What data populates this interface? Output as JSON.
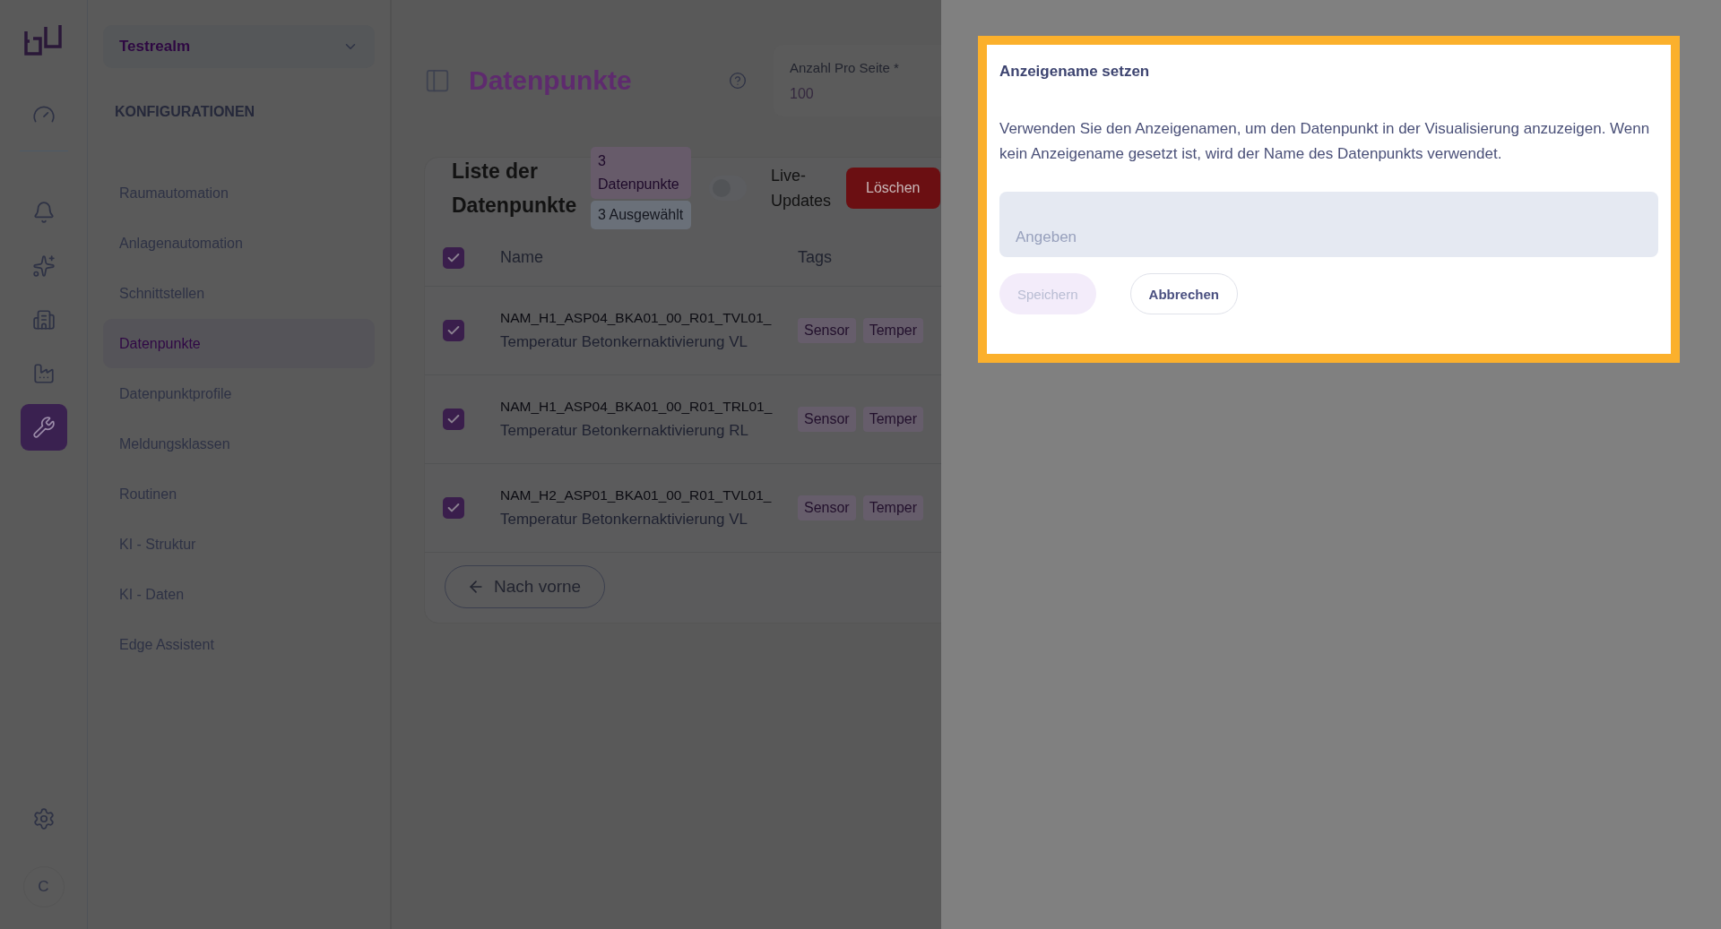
{
  "rail": {
    "items": [
      {
        "selected": false
      },
      {
        "selected": false
      },
      {
        "selected": false
      },
      {
        "selected": false
      },
      {
        "selected": false
      },
      {
        "selected": true
      }
    ],
    "avatar": "C"
  },
  "sidebar": {
    "realm": "Testrealm",
    "section": "KONFIGURATIONEN",
    "items": [
      {
        "label": "Raumautomation",
        "selected": false
      },
      {
        "label": "Anlagenautomation",
        "selected": false
      },
      {
        "label": "Schnittstellen",
        "selected": false
      },
      {
        "label": "Datenpunkte",
        "selected": true
      },
      {
        "label": "Datenpunktprofile",
        "selected": false
      },
      {
        "label": "Meldungsklassen",
        "selected": false
      },
      {
        "label": "Routinen",
        "selected": false
      },
      {
        "label": "KI - Struktur",
        "selected": false
      },
      {
        "label": "KI - Daten",
        "selected": false
      },
      {
        "label": "Edge Assistent",
        "selected": false
      }
    ]
  },
  "page": {
    "title": "Datenpunkte",
    "per_page": {
      "label": "Anzahl Pro Seite *",
      "value": "100"
    },
    "list": {
      "title": "Liste der Datenpunkte",
      "badges": [
        {
          "text": "3 Datenpunkte",
          "kind": "count"
        },
        {
          "text": "3 Ausgewählt",
          "kind": "selection"
        }
      ],
      "live_updates": {
        "label": "Live-Updates",
        "on": false
      },
      "delete_button": "Löschen",
      "select_all": {
        "checked": true
      },
      "columns": [
        "Name",
        "Tags"
      ],
      "rows": [
        {
          "checked": true,
          "name": "NAM_H1_ASP04_BKA01_00_R01_TVL01_",
          "description": "Temperatur Betonkernaktivierung VL",
          "tags": [
            "Sensor",
            "Temper"
          ]
        },
        {
          "checked": true,
          "name": "NAM_H1_ASP04_BKA01_00_R01_TRL01_",
          "description": "Temperatur Betonkernaktivierung RL",
          "tags": [
            "Sensor",
            "Temper"
          ]
        },
        {
          "checked": true,
          "name": "NAM_H2_ASP01_BKA01_00_R01_TVL01_",
          "description": "Temperatur Betonkernaktivierung VL",
          "tags": [
            "Sensor",
            "Temper"
          ]
        }
      ],
      "back_button": "Nach vorne"
    }
  },
  "dialog": {
    "title": "Anzeigename setzen",
    "text": "Verwenden Sie den Anzeigenamen, um den Datenpunkt in der Visualisierung anzuzeigen. Wenn kein Anzeigename gesetzt ist, wird der Name des Datenpunkts verwendet.",
    "input": {
      "placeholder": "Angeben"
    },
    "save": {
      "label": "Speichern",
      "disabled": true
    },
    "cancel": {
      "label": "Abbrechen"
    }
  }
}
